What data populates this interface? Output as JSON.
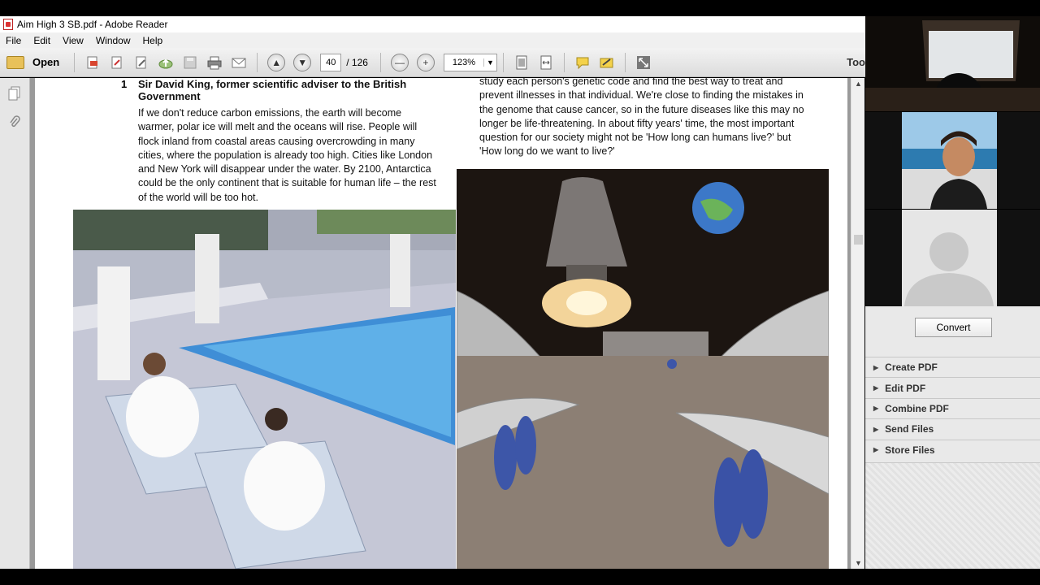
{
  "window": {
    "title": "Aim High 3 SB.pdf - Adobe Reader"
  },
  "menu": [
    "File",
    "Edit",
    "View",
    "Window",
    "Help"
  ],
  "toolbar": {
    "open_label": "Open",
    "page_current": "40",
    "page_total": "/ 126",
    "zoom": "123%",
    "tools_label": "Too"
  },
  "document": {
    "item_number": "1",
    "heading": "Sir David King, former scientific adviser to the British Government",
    "paragraph1": "If we don't reduce carbon emissions, the earth will become warmer, polar ice will melt and the oceans will rise. People will flock inland from coastal areas causing overcrowding in many cities, where the population is already too high. Cities like London and New York will disappear under the water. By 2100, Antarctica could be the only continent that is suitable for human life – the rest of the world will be too hot.",
    "paragraph2": "study each person's genetic code and find the best way to treat and prevent illnesses in that individual. We're close to finding the mistakes in the genome that cause cancer, so in the future diseases like this may no longer be life-threatening. In about fifty years' time, the most important question for our society might not be 'How long can humans live?' but 'How long do we want to live?'"
  },
  "panel": {
    "convert_label": "Convert",
    "items": [
      "Create PDF",
      "Edit PDF",
      "Combine PDF",
      "Send Files",
      "Store Files"
    ]
  }
}
